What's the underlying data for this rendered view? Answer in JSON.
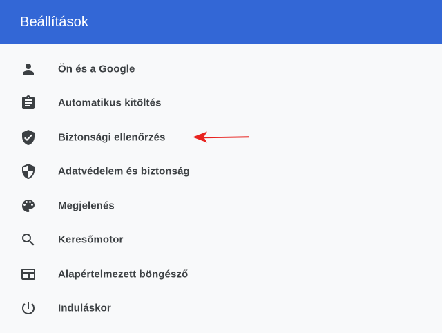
{
  "header": {
    "title": "Beállítások"
  },
  "colors": {
    "accent": "#3367d6",
    "arrow": "#e8231f"
  },
  "menu": {
    "items": [
      {
        "label": "Ön és a Google",
        "icon": "person-icon"
      },
      {
        "label": "Automatikus kitöltés",
        "icon": "clipboard-icon"
      },
      {
        "label": "Biztonsági ellenőrzés",
        "icon": "shield-check-icon",
        "annotated": true
      },
      {
        "label": "Adatvédelem és biztonság",
        "icon": "shield-half-icon"
      },
      {
        "label": "Megjelenés",
        "icon": "palette-icon"
      },
      {
        "label": "Keresőmotor",
        "icon": "search-icon"
      },
      {
        "label": "Alapértelmezett böngésző",
        "icon": "browser-icon"
      },
      {
        "label": "Induláskor",
        "icon": "power-icon"
      }
    ]
  }
}
